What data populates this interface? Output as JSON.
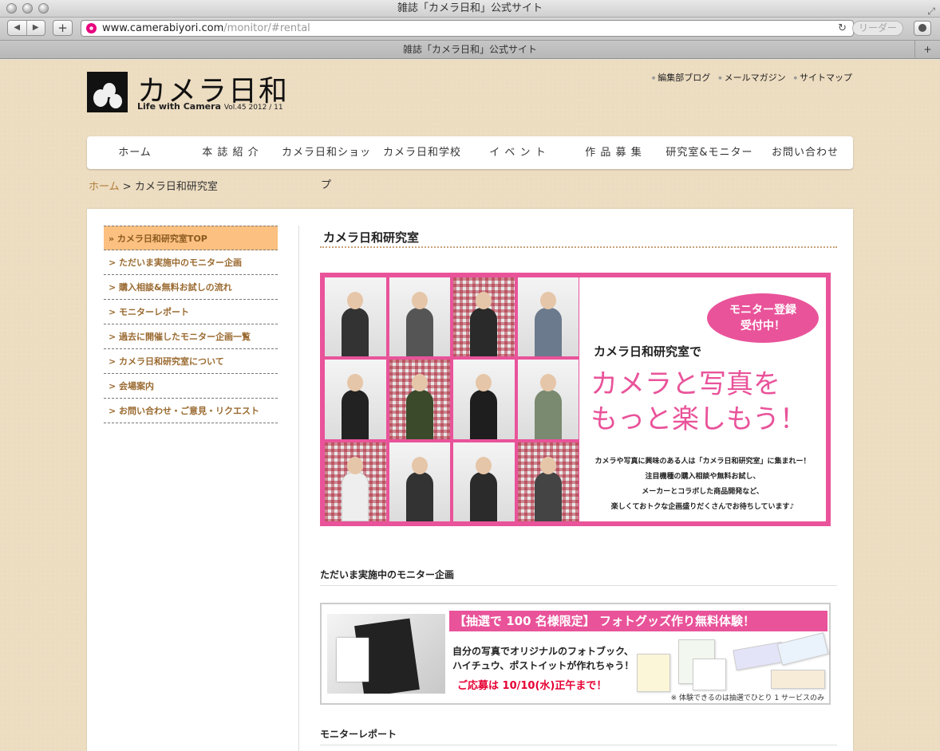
{
  "browser": {
    "window_title": "雑誌「カメラ日和」公式サイト",
    "url_host": "www.camerabiyori.com",
    "url_path": "/monitor/#rental",
    "reader_label": "リーダー",
    "tab_title": "雑誌「カメラ日和」公式サイト"
  },
  "site": {
    "logo_text": "カメラ日和",
    "logo_sub": "Life with Camera",
    "logo_vol": "Vol.45  2012 / 11",
    "top_links": [
      "編集部ブログ",
      "メールマガジン",
      "サイトマップ"
    ]
  },
  "nav": [
    "ホーム",
    "本 誌 紹 介",
    "カメラ日和ショップ",
    "カメラ日和学校",
    "イ ベ ン ト",
    "作 品 募 集",
    "研究室&モニター",
    "お問い合わせ"
  ],
  "breadcrumb": {
    "home": "ホーム",
    "sep": ">",
    "current": "カメラ日和研究室"
  },
  "sidebar": [
    "» カメラ日和研究室TOP",
    "> ただいま実施中のモニター企画",
    "> 購入相談&無料お試しの流れ",
    "> モニターレポート",
    "> 過去に開催したモニター企画一覧",
    "> カメラ日和研究室について",
    "> 会場案内",
    "> お問い合わせ・ご意見・リクエスト"
  ],
  "main": {
    "title": "カメラ日和研究室",
    "hero": {
      "badge_line1": "モニター登録",
      "badge_line2": "受付中！",
      "sub": "カメラ日和研究室で",
      "big_line1": "カメラと写真を",
      "big_line2": "もっと楽しもう！",
      "desc": [
        "カメラや写真に興味のある人は「カメラ日和研究室」に集まれー！",
        "注目機種の購入相談や無料お試し、",
        "メーカーとコラボした商品開発など、",
        "楽しくておトクな企画盛りだくさんでお待ちしています♪"
      ]
    },
    "section1_title": "ただいま実施中のモニター企画",
    "banner": {
      "head": "【抽選で 100 名様限定】 フォトグッズ作り無料体験！",
      "line1": "自分の写真でオリジナルのフォトブック、",
      "line2": "ハイチュウ、ポストイットが作れちゃう！",
      "deadline": "ご応募は 10/10(水)正午まで！",
      "note": "※ 体験できるのは抽選でひとり 1 サービスのみ"
    },
    "section2_title": "モニターレポート"
  },
  "colors": {
    "accent_pink": "#e9539a",
    "sidebar_active": "#fcc080",
    "link_brown": "#b07d3c"
  }
}
